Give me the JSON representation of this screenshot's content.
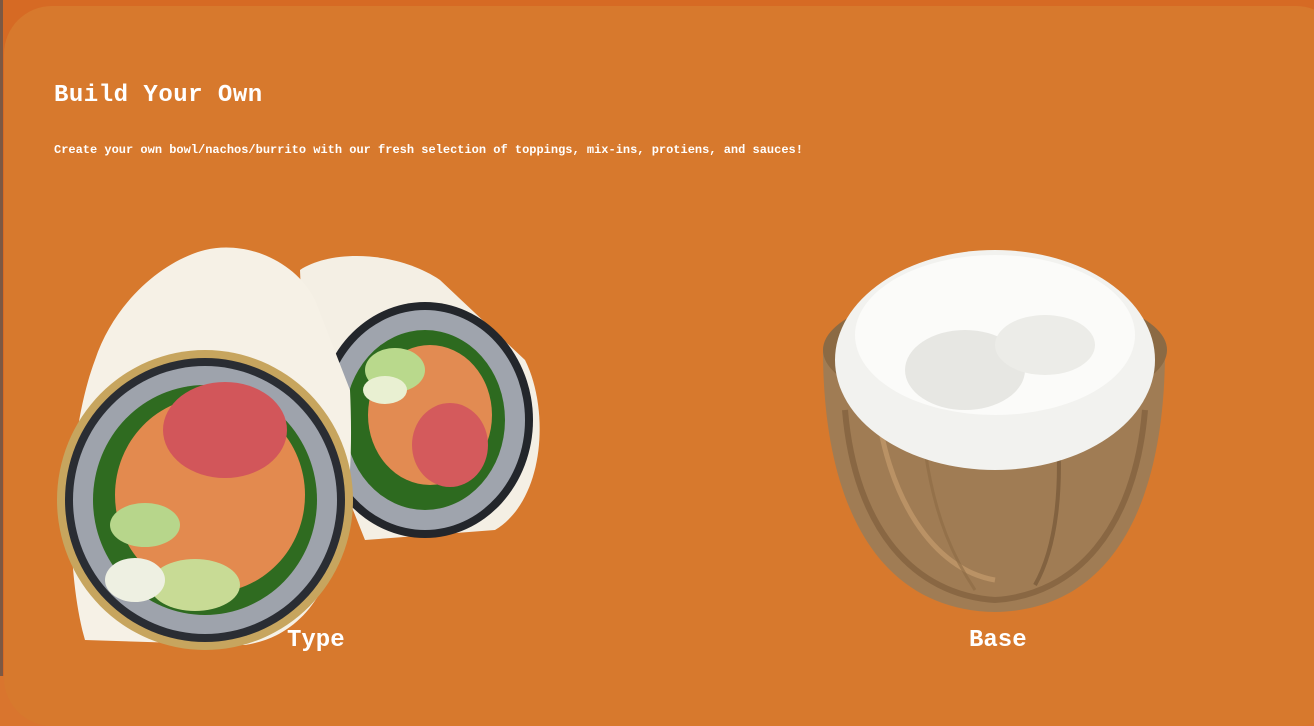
{
  "header": {
    "title": "Build Your Own",
    "subtitle": "Create your own bowl/nachos/burrito with our fresh selection of toppings, mix-ins, protiens, and sauces!"
  },
  "options": [
    {
      "label": "Type",
      "image_icon": "sushi-burrito-image"
    },
    {
      "label": "Base",
      "image_icon": "rice-bowl-image"
    }
  ],
  "colors": {
    "background": "#d7792d",
    "text": "#ffffff"
  }
}
